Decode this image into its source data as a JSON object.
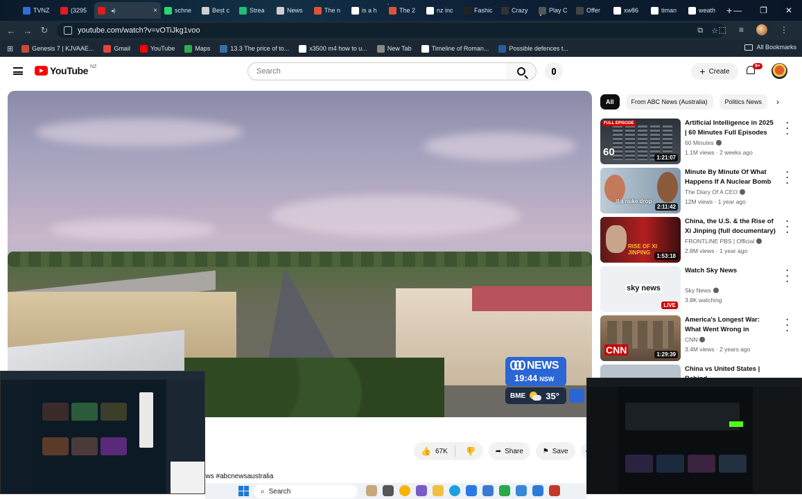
{
  "browser": {
    "tabs": [
      {
        "label": "TVNZ",
        "color": "#2f6fd6"
      },
      {
        "label": "(3295",
        "color": "#e01c1c"
      },
      {
        "label": "",
        "color": "#e01c1c",
        "active": true
      },
      {
        "label": "schne",
        "color": "#2bd66b"
      },
      {
        "label": "Best c",
        "color": "#cfcfcf"
      },
      {
        "label": "Strea",
        "color": "#1dbf7a"
      },
      {
        "label": "News",
        "color": "#cfcfcf"
      },
      {
        "label": "The n",
        "color": "#e0533a"
      },
      {
        "label": "is a h",
        "color": "#ffffff"
      },
      {
        "label": "The 2",
        "color": "#e0533a"
      },
      {
        "label": "nz inc",
        "color": "#ffffff"
      },
      {
        "label": "Fashic",
        "color": "#222222"
      },
      {
        "label": "Crazy",
        "color": "#333333"
      },
      {
        "label": "Play C",
        "color": "#555555"
      },
      {
        "label": "Offer",
        "color": "#444444"
      },
      {
        "label": "xw86",
        "color": "#ffffff"
      },
      {
        "label": "timan",
        "color": "#ffffff"
      },
      {
        "label": "weath",
        "color": "#ffffff"
      }
    ],
    "url": "youtube.com/watch?v=vOTiJkg1voo",
    "bookmarks": [
      {
        "label": "Genesis 7 | KJVAAE...",
        "color": "#c84a3a"
      },
      {
        "label": "Gmail",
        "color": "#ea4335"
      },
      {
        "label": "YouTube",
        "color": "#ff0000"
      },
      {
        "label": "Maps",
        "color": "#34a853"
      },
      {
        "label": "13.3 The price of to...",
        "color": "#3a6ea5"
      },
      {
        "label": "x3500 m4 how to u...",
        "color": "#ffffff"
      },
      {
        "label": "New Tab",
        "color": "#888888"
      },
      {
        "label": "Timeline of Roman...",
        "color": "#ffffff"
      },
      {
        "label": "Possible defences t...",
        "color": "#2a5b9c"
      }
    ],
    "all_bookmarks": "All Bookmarks"
  },
  "youtube": {
    "logo_text": "YouTube",
    "country": "NZ",
    "search_placeholder": "Search",
    "create_label": "Create",
    "notification_count": "9+",
    "video": {
      "channel_bug": "NEWS",
      "time": "19:44",
      "timezone": "NSW",
      "weather_location": "BME",
      "temperature": "35°"
    },
    "actions": {
      "likes": "67K",
      "share": "Share",
      "save": "Save"
    },
    "hashtags": "ews #abcnewsaustralia",
    "chips": [
      "All",
      "From ABC News (Australia)",
      "Politics News"
    ],
    "recommendations": [
      {
        "title": "Artificial Intelligence in 2025 | 60 Minutes Full Episodes",
        "channel": "60 Minutes",
        "verified": true,
        "meta": "1.1M views · 2 weeks ago",
        "duration": "1:21:07",
        "badge": "FULL EPISODE",
        "thumb": "ai"
      },
      {
        "title": "Minute By Minute Of What Happens If A Nuclear Bomb ...",
        "channel": "The Diary Of A CEO",
        "verified": true,
        "meta": "12M views · 1 year ago",
        "duration": "2:11:42",
        "badge": "if a nuke drop",
        "thumb": "nuke"
      },
      {
        "title": "China, the U.S. & the Rise of Xi Jinping (full documentary) | ...",
        "channel": "FRONTLINE PBS | Official",
        "verified": true,
        "meta": "2.8M views · 1 year ago",
        "duration": "1:53:18",
        "badge": "RISE OF XI JINPING",
        "thumb": "xi"
      },
      {
        "title": "Watch Sky News",
        "channel": "Sky News",
        "verified": true,
        "meta": "3.8K watching",
        "duration": "LIVE",
        "badge": "sky news",
        "thumb": "sky"
      },
      {
        "title": "America's Longest War: What Went Wrong in Afghanistan ...",
        "channel": "CNN",
        "verified": true,
        "meta": "3.4M views · 2 years ago",
        "duration": "1:29:39",
        "badge": "CNN",
        "thumb": "cnn"
      },
      {
        "title": "China vs United States | Behind",
        "channel": "",
        "verified": false,
        "meta": "",
        "duration": "",
        "badge": "",
        "thumb": "china"
      }
    ]
  },
  "taskbar": {
    "search_label": "Search"
  },
  "colors": {
    "yt_red": "#ff0000",
    "abc_blue": "#2a66d4",
    "live_red": "#cc0000"
  }
}
